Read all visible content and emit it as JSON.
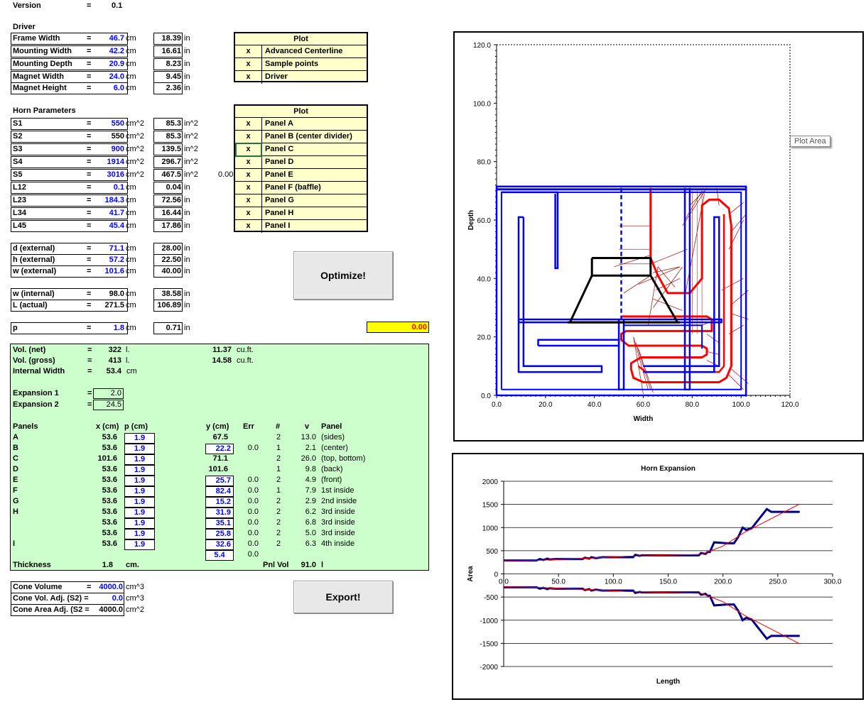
{
  "version": {
    "label": "Version",
    "eq": "=",
    "value": "0.1"
  },
  "driver": {
    "title": "Driver",
    "rows": [
      {
        "label": "Frame Width",
        "eq": "=",
        "cm": "46.7",
        "cm_unit": "cm",
        "in": "18.39",
        "in_unit": "in"
      },
      {
        "label": "Mounting Width",
        "eq": "=",
        "cm": "42.2",
        "cm_unit": "cm",
        "in": "16.61",
        "in_unit": "in"
      },
      {
        "label": "Mounting Depth",
        "eq": "=",
        "cm": "20.9",
        "cm_unit": "cm",
        "in": "8.23",
        "in_unit": "in"
      },
      {
        "label": "Magnet Width",
        "eq": "=",
        "cm": "24.0",
        "cm_unit": "cm",
        "in": "9.45",
        "in_unit": "in"
      },
      {
        "label": "Magnet Height",
        "eq": "=",
        "cm": "6.0",
        "cm_unit": "cm",
        "in": "2.36",
        "in_unit": "in"
      }
    ]
  },
  "plot1": {
    "header": "Plot",
    "items": [
      {
        "x": "x",
        "label": "Advanced Centerline"
      },
      {
        "x": "x",
        "label": "Sample points"
      },
      {
        "x": "x",
        "label": "Driver"
      }
    ]
  },
  "horn": {
    "title": "Horn Parameters",
    "rows": [
      {
        "label": "S1",
        "eq": "=",
        "v": "550",
        "u": "cm^2",
        "v2": "85.3",
        "u2": "in^2"
      },
      {
        "label": "S2",
        "eq": "=",
        "v": "550",
        "u": "cm^2",
        "v2": "85.3",
        "u2": "in^2"
      },
      {
        "label": "S3",
        "eq": "=",
        "v": "900",
        "u": "cm^2",
        "v2": "139.5",
        "u2": "in^2"
      },
      {
        "label": "S4",
        "eq": "=",
        "v": "1914",
        "u": "cm^2",
        "v2": "296.7",
        "u2": "in^2"
      },
      {
        "label": "S5",
        "eq": "=",
        "v": "3016",
        "u": "cm^2",
        "v2": "467.5",
        "u2": "in^2"
      },
      {
        "label": "L12",
        "eq": "=",
        "v": "0.1",
        "u": "cm",
        "v2": "0.04",
        "u2": "in"
      },
      {
        "label": "L23",
        "eq": "=",
        "v": "184.3",
        "u": "cm",
        "v2": "72.56",
        "u2": "in"
      },
      {
        "label": "L34",
        "eq": "=",
        "v": "41.7",
        "u": "cm",
        "v2": "16.44",
        "u2": "in"
      },
      {
        "label": "L45",
        "eq": "=",
        "v": "45.4",
        "u": "cm",
        "v2": "17.86",
        "u2": "in"
      }
    ],
    "s5_extra": "0.00"
  },
  "plot2": {
    "header": "Plot",
    "items": [
      {
        "x": "x",
        "label": "Panel A"
      },
      {
        "x": "x",
        "label": "Panel B (center divider)"
      },
      {
        "x": "x",
        "label": "Panel C"
      },
      {
        "x": "x",
        "label": "Panel D"
      },
      {
        "x": "x",
        "label": "Panel E"
      },
      {
        "x": "x",
        "label": "Panel F (baffle)"
      },
      {
        "x": "x",
        "label": "Panel G"
      },
      {
        "x": "x",
        "label": "Panel H"
      },
      {
        "x": "x",
        "label": "Panel I"
      }
    ]
  },
  "external": [
    {
      "label": "d (external)",
      "eq": "=",
      "cm": "71.1",
      "cm_unit": "cm",
      "in": "28.00",
      "in_unit": "in"
    },
    {
      "label": "h (external)",
      "eq": "=",
      "cm": "57.2",
      "cm_unit": "cm",
      "in": "22.50",
      "in_unit": "in"
    },
    {
      "label": "w (external)",
      "eq": "=",
      "cm": "101.6",
      "cm_unit": "cm",
      "in": "40.00",
      "in_unit": "in"
    }
  ],
  "internal": [
    {
      "label": "w (internal)",
      "eq": "=",
      "cm": "98.0",
      "cm_unit": "cm",
      "in": "38.58",
      "in_unit": "in"
    },
    {
      "label": "L (actual)",
      "eq": "=",
      "cm": "271.5",
      "cm_unit": "cm",
      "in": "106.89",
      "in_unit": "in"
    }
  ],
  "p": {
    "label": "p",
    "eq": "=",
    "cm": "1.8",
    "cm_unit": "cm",
    "in": "0.71",
    "in_unit": "in"
  },
  "optimize_label": "Optimize!",
  "export_label": "Export!",
  "yellow_result": "0.00",
  "vol": {
    "net": {
      "label": "Vol. (net)",
      "eq": "=",
      "v": "322",
      "u": "l.",
      "v2": "11.37",
      "u2": "cu.ft."
    },
    "gross": {
      "label": "Vol. (gross)",
      "eq": "=",
      "v": "413",
      "u": "l.",
      "v2": "14.58",
      "u2": "cu.ft."
    },
    "iw": {
      "label": "Internal Width",
      "eq": "=",
      "v": "53.4",
      "u": "cm"
    }
  },
  "expansion": [
    {
      "label": "Expansion 1",
      "eq": "=",
      "v": "2.0"
    },
    {
      "label": "Expansion 2",
      "eq": "=",
      "v": "24.5"
    }
  ],
  "panels": {
    "headers": {
      "panels": "Panels",
      "x": "x (cm)",
      "p": "p (cm)",
      "y": "y (cm)",
      "err": "Err",
      "n": "#",
      "v": "v",
      "panel": "Panel"
    },
    "rows": [
      {
        "name": "A",
        "x": "53.6",
        "p": "1.9",
        "y": "67.5",
        "ybox": false,
        "err": "",
        "n": "2",
        "v": "13.0",
        "panel": "(sides)"
      },
      {
        "name": "B",
        "x": "53.6",
        "p": "1.9",
        "y": "22.2",
        "ybox": true,
        "err": "0.0",
        "n": "1",
        "v": "2.1",
        "panel": "(center)"
      },
      {
        "name": "C",
        "x": "101.6",
        "p": "1.9",
        "y": "71.1",
        "ybox": false,
        "err": "",
        "n": "2",
        "v": "26.0",
        "panel": "(top, bottom)"
      },
      {
        "name": "D",
        "x": "53.6",
        "p": "1.9",
        "y": "101.6",
        "ybox": false,
        "err": "",
        "n": "1",
        "v": "9.8",
        "panel": "(back)"
      },
      {
        "name": "E",
        "x": "53.6",
        "p": "1.9",
        "y": "25.7",
        "ybox": true,
        "err": "0.0",
        "n": "2",
        "v": "4.9",
        "panel": "(front)"
      },
      {
        "name": "F",
        "x": "53.6",
        "p": "1.9",
        "y": "82.4",
        "ybox": true,
        "err": "0.0",
        "n": "1",
        "v": "7.9",
        "panel": "1st inside"
      },
      {
        "name": "G",
        "x": "53.6",
        "p": "1.9",
        "y": "15.2",
        "ybox": true,
        "err": "0.0",
        "n": "2",
        "v": "2.9",
        "panel": "2nd inside"
      },
      {
        "name": "H",
        "x": "53.6",
        "p": "1.9",
        "y": "31.9",
        "ybox": true,
        "err": "0.0",
        "n": "2",
        "v": "6.2",
        "panel": "3rd inside"
      },
      {
        "name": "",
        "x": "53.6",
        "p": "1.9",
        "y": "35.1",
        "ybox": true,
        "err": "0.0",
        "n": "2",
        "v": "6.8",
        "panel": "3rd inside"
      },
      {
        "name": "",
        "x": "53.6",
        "p": "1.9",
        "y": "25.8",
        "ybox": true,
        "err": "0.0",
        "n": "2",
        "v": "5.0",
        "panel": "3rd inside"
      },
      {
        "name": "I",
        "x": "53.6",
        "p": "1.9",
        "y": "32.6",
        "ybox": true,
        "err": "0.0",
        "n": "2",
        "v": "6.3",
        "panel": "4th inside"
      }
    ],
    "extra_y": "5.4",
    "extra_err": "0.0",
    "thickness": {
      "label": "Thickness",
      "v": "1.8",
      "u": "cm."
    },
    "pnlvol": {
      "label": "Pnl Vol",
      "v": "91.0",
      "u": "l"
    }
  },
  "cone": [
    {
      "label": "Cone Volume",
      "eq": "=",
      "v": "4000.0",
      "u": "cm^3"
    },
    {
      "label": "Cone Vol. Adj. (S2) =",
      "eq": "",
      "v": "0.0",
      "u": "cm^3"
    },
    {
      "label": "Cone Area Adj. (S2 =",
      "eq": "",
      "v": "4000.0",
      "u": "cm^2"
    }
  ],
  "colors": {
    "blue": "#0000ff",
    "red": "#ff0000",
    "darkred": "#a00000",
    "navy": "#000080",
    "green": "#ccffcc",
    "yellow": "#ffffcc",
    "brightyellow": "#ffff00"
  },
  "chart_data": [
    {
      "type": "line",
      "title": "",
      "xlabel": "Width",
      "ylabel": "Depth",
      "xlim": [
        0,
        120
      ],
      "ylim": [
        0,
        120
      ],
      "xticks": [
        "0.0",
        "20.0",
        "40.0",
        "60.0",
        "80.0",
        "100.0",
        "120.0"
      ],
      "yticks": [
        "0.0",
        "20.0",
        "40.0",
        "60.0",
        "80.0",
        "100.0",
        "120.0"
      ],
      "annotation": "Plot Area"
    },
    {
      "type": "line",
      "title": "Horn Expansion",
      "xlabel": "Length",
      "ylabel": "Area",
      "xlim": [
        0,
        300
      ],
      "ylim": [
        -2000,
        2000
      ],
      "xticks": [
        "0.0",
        "50.0",
        "100.0",
        "150.0",
        "200.0",
        "250.0",
        "300.0"
      ],
      "yticks": [
        "2000",
        "1500",
        "1000",
        "500",
        "0",
        "-500",
        "-1000",
        "-1500",
        "-2000"
      ],
      "series": [
        {
          "color": "#000080",
          "x": [
            0,
            30,
            33,
            36,
            40,
            42,
            47,
            50,
            72,
            74,
            78,
            80,
            84,
            90,
            118,
            120,
            124,
            126,
            178,
            180,
            184,
            186,
            188,
            192,
            204,
            210,
            214,
            218,
            221,
            226,
            240,
            244,
            270
          ],
          "y": [
            290,
            290,
            320,
            300,
            330,
            310,
            320,
            320,
            320,
            350,
            330,
            360,
            340,
            360,
            360,
            410,
            390,
            400,
            400,
            450,
            430,
            470,
            470,
            680,
            660,
            660,
            800,
            1000,
            950,
            980,
            1400,
            1340,
            1340
          ]
        },
        {
          "color": "#ff0000",
          "x": [
            0,
            30,
            50,
            80,
            110,
            180,
            200,
            220,
            270
          ],
          "y": [
            280,
            290,
            310,
            340,
            380,
            420,
            600,
            900,
            1510
          ]
        }
      ]
    }
  ]
}
